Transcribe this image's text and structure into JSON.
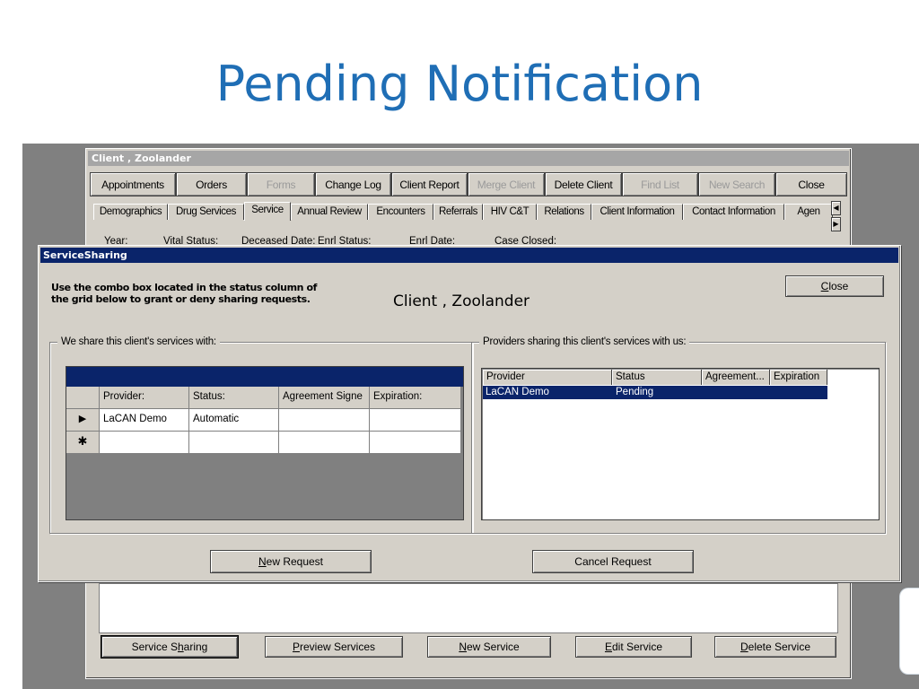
{
  "slide": {
    "title": "Pending Notification"
  },
  "client_window": {
    "title": "Client , Zoolander",
    "toolbar": [
      {
        "label": "Appointments",
        "enabled": true
      },
      {
        "label": "Orders",
        "enabled": true
      },
      {
        "label": "Forms",
        "enabled": false
      },
      {
        "label": "Change Log",
        "enabled": true
      },
      {
        "label": "Client Report",
        "enabled": true
      },
      {
        "label": "Merge Client",
        "enabled": false
      },
      {
        "label": "Delete Client",
        "enabled": true
      },
      {
        "label": "Find List",
        "enabled": false
      },
      {
        "label": "New Search",
        "enabled": false
      },
      {
        "label": "Close",
        "enabled": true
      }
    ],
    "tabs": [
      "Demographics",
      "Drug Services",
      "Service",
      "Annual Review",
      "Encounters",
      "Referrals",
      "HIV C&T",
      "Relations",
      "Client Information",
      "Contact Information",
      "Agen"
    ],
    "active_tab": "Service",
    "field_labels": [
      "Year:",
      "Vital Status:",
      "Deceased Date:",
      "Enrl Status:",
      "Enrl Date:",
      "Case Closed:"
    ],
    "bottom_buttons": {
      "service_sharing": {
        "pre": "Service S",
        "key": "h",
        "post": "aring"
      },
      "preview_services": {
        "pre": "",
        "key": "P",
        "post": "review Services"
      },
      "new_service": {
        "pre": "",
        "key": "N",
        "post": "ew Service"
      },
      "edit_service": {
        "pre": "",
        "key": "E",
        "post": "dit Service"
      },
      "delete_service": {
        "pre": "",
        "key": "D",
        "post": "elete Service"
      }
    }
  },
  "service_sharing": {
    "title": "ServiceSharing",
    "instructions_line1": "Use the combo box located in the status column of",
    "instructions_line2": "the grid below to grant or deny sharing requests.",
    "client_name": "Client , Zoolander",
    "close": {
      "key": "C",
      "post": "lose"
    },
    "left_group": {
      "legend": "We share this client's services with:",
      "columns": [
        "Provider:",
        "Status:",
        "Agreement Signe",
        "Expiration:"
      ],
      "rows": [
        {
          "indicator": "▶",
          "provider": "LaCAN Demo",
          "status": "Automatic",
          "agreement": "",
          "expiration": ""
        }
      ],
      "new_row_indicator": "✱"
    },
    "right_group": {
      "legend": "Providers sharing this client's services with us:",
      "columns": [
        "Provider",
        "Status",
        "Agreement...",
        "Expiration"
      ],
      "rows": [
        {
          "provider": "LaCAN Demo",
          "status": "Pending"
        }
      ]
    },
    "new_request": {
      "key": "N",
      "post": "ew Request"
    },
    "cancel_request": {
      "label": "Cancel Request"
    }
  },
  "colors": {
    "title_blue": "#1f6eb5",
    "selection": "#0a246a",
    "dialog_face": "#d4d0c8"
  }
}
